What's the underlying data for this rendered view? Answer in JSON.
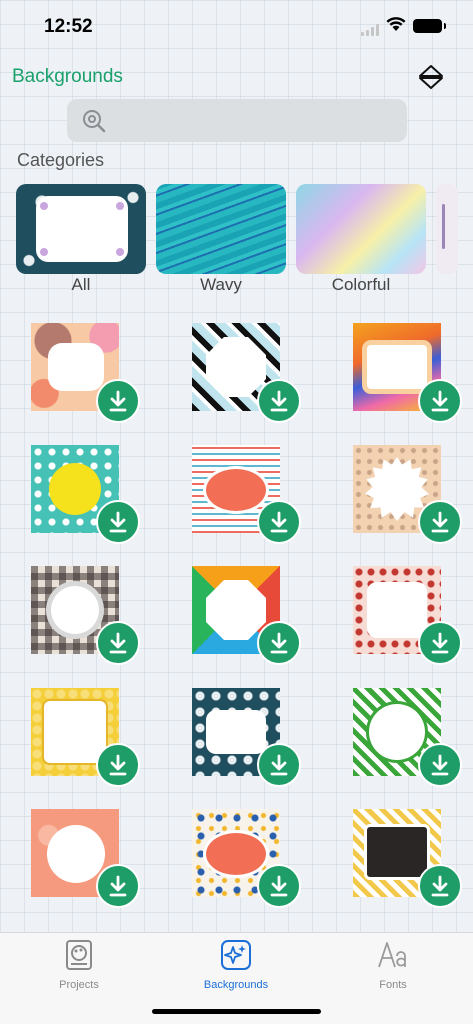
{
  "status": {
    "time": "12:52"
  },
  "header": {
    "title": "Backgrounds"
  },
  "search": {
    "placeholder": ""
  },
  "categories": {
    "heading": "Categories",
    "items": [
      {
        "label": "All"
      },
      {
        "label": "Wavy"
      },
      {
        "label": "Colorful"
      }
    ]
  },
  "tabs": [
    {
      "label": "Projects",
      "icon": "palette-icon",
      "active": false
    },
    {
      "label": "Backgrounds",
      "icon": "sparkles-icon",
      "active": true
    },
    {
      "label": "Fonts",
      "icon": "font-icon",
      "active": false
    }
  ],
  "colors": {
    "accent": "#1aa06b",
    "download": "#1f9d68",
    "tab_active": "#1c6fd6"
  }
}
